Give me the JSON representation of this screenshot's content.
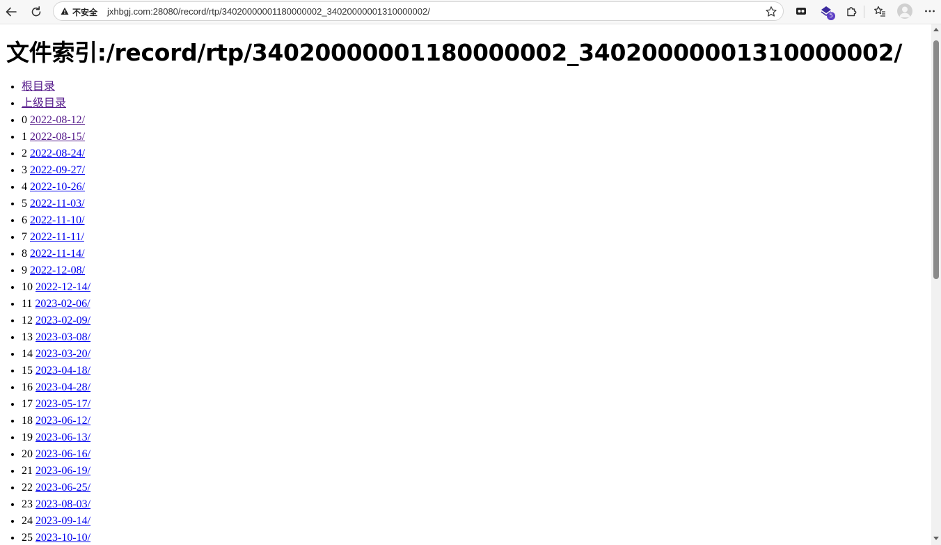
{
  "browser": {
    "security_label": "不安全",
    "url": "jxhbgj.com:28080/record/rtp/34020000001180000002_34020000001310000002/",
    "extension_badge": "5",
    "icons": [
      "back-arrow-icon",
      "reload-icon",
      "warning-triangle-icon",
      "star-icon",
      "extension-icon",
      "puzzle-icon",
      "favorites-icon",
      "profile-avatar",
      "more-icon"
    ]
  },
  "page": {
    "title": "文件索引:/record/rtp/34020000001180000002_34020000001310000002/",
    "root_link": "根目录",
    "parent_link": "上级目录",
    "entries": [
      {
        "index": "0",
        "name": "2022-08-12/",
        "visited": true
      },
      {
        "index": "1",
        "name": "2022-08-15/",
        "visited": true
      },
      {
        "index": "2",
        "name": "2022-08-24/",
        "visited": false
      },
      {
        "index": "3",
        "name": "2022-09-27/",
        "visited": false
      },
      {
        "index": "4",
        "name": "2022-10-26/",
        "visited": false
      },
      {
        "index": "5",
        "name": "2022-11-03/",
        "visited": false
      },
      {
        "index": "6",
        "name": "2022-11-10/",
        "visited": false
      },
      {
        "index": "7",
        "name": "2022-11-11/",
        "visited": false
      },
      {
        "index": "8",
        "name": "2022-11-14/",
        "visited": false
      },
      {
        "index": "9",
        "name": "2022-12-08/",
        "visited": false
      },
      {
        "index": "10",
        "name": "2022-12-14/",
        "visited": false
      },
      {
        "index": "11",
        "name": "2023-02-06/",
        "visited": false
      },
      {
        "index": "12",
        "name": "2023-02-09/",
        "visited": false
      },
      {
        "index": "13",
        "name": "2023-03-08/",
        "visited": false
      },
      {
        "index": "14",
        "name": "2023-03-20/",
        "visited": false
      },
      {
        "index": "15",
        "name": "2023-04-18/",
        "visited": false
      },
      {
        "index": "16",
        "name": "2023-04-28/",
        "visited": false
      },
      {
        "index": "17",
        "name": "2023-05-17/",
        "visited": false
      },
      {
        "index": "18",
        "name": "2023-06-12/",
        "visited": false
      },
      {
        "index": "19",
        "name": "2023-06-13/",
        "visited": false
      },
      {
        "index": "20",
        "name": "2023-06-16/",
        "visited": false
      },
      {
        "index": "21",
        "name": "2023-06-19/",
        "visited": false
      },
      {
        "index": "22",
        "name": "2023-06-25/",
        "visited": false
      },
      {
        "index": "23",
        "name": "2023-08-03/",
        "visited": false
      },
      {
        "index": "24",
        "name": "2023-09-14/",
        "visited": false
      },
      {
        "index": "25",
        "name": "2023-10-10/",
        "visited": false
      }
    ]
  },
  "colors": {
    "link": "#0000ee",
    "visited_link": "#551a8b",
    "badge": "#5b3dc4"
  }
}
